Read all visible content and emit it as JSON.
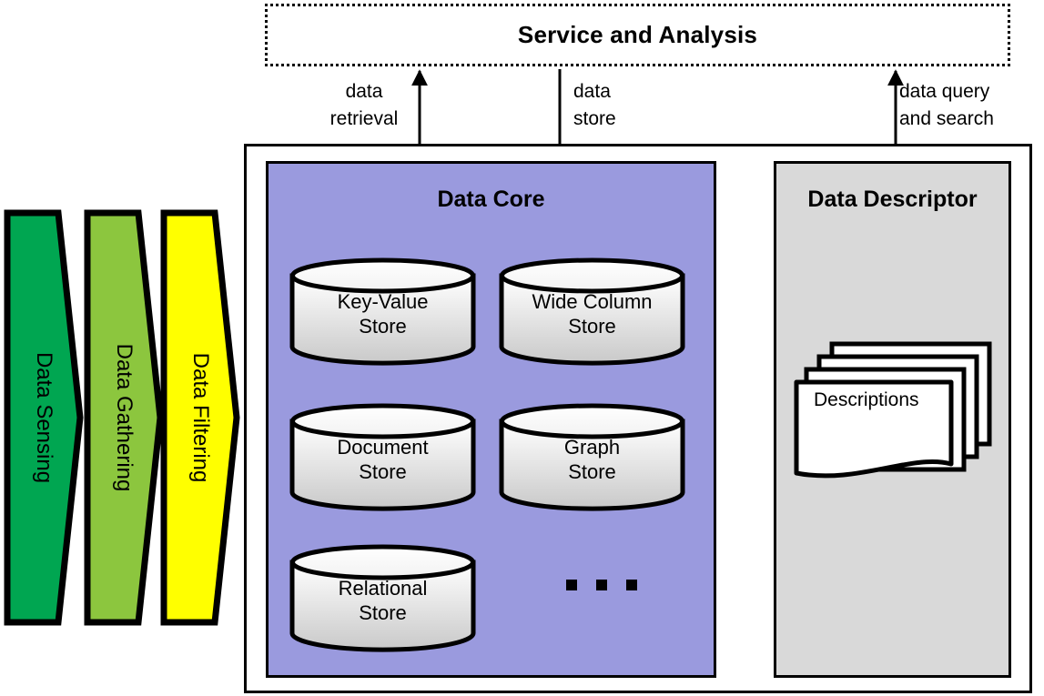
{
  "diagram": {
    "title": "Service and Analysis",
    "service_layer": {
      "label": "Service and Analysis"
    },
    "flows": [
      {
        "id": "data-retrieval",
        "label": "data\nretrieval",
        "direction": "up"
      },
      {
        "id": "data-store",
        "label": "data\nstore",
        "direction": "down"
      },
      {
        "id": "data-query-search",
        "label": "data query\nand search",
        "direction": "both"
      }
    ],
    "pipeline": [
      {
        "id": "data-sensing",
        "label": "Data Sensing",
        "color": "#00a651"
      },
      {
        "id": "data-gathering",
        "label": "Data Gathering",
        "color": "#8cc63e"
      },
      {
        "id": "data-filtering",
        "label": "Data Filtering",
        "color": "#ffff00"
      }
    ],
    "data_core": {
      "title": "Data Core",
      "color": "#9a9ade",
      "stores": [
        {
          "id": "key-value-store",
          "label": "Key-Value\nStore"
        },
        {
          "id": "wide-column-store",
          "label": "Wide Column\nStore"
        },
        {
          "id": "document-store",
          "label": "Document\nStore"
        },
        {
          "id": "graph-store",
          "label": "Graph\nStore"
        },
        {
          "id": "relational-store",
          "label": "Relational\nStore"
        }
      ],
      "ellipsis": "• • •"
    },
    "data_descriptor": {
      "title": "Data Descriptor",
      "color": "#d9d9d9",
      "documents_label": "Descriptions"
    },
    "core_descriptor_link": {
      "direction": "both"
    }
  }
}
